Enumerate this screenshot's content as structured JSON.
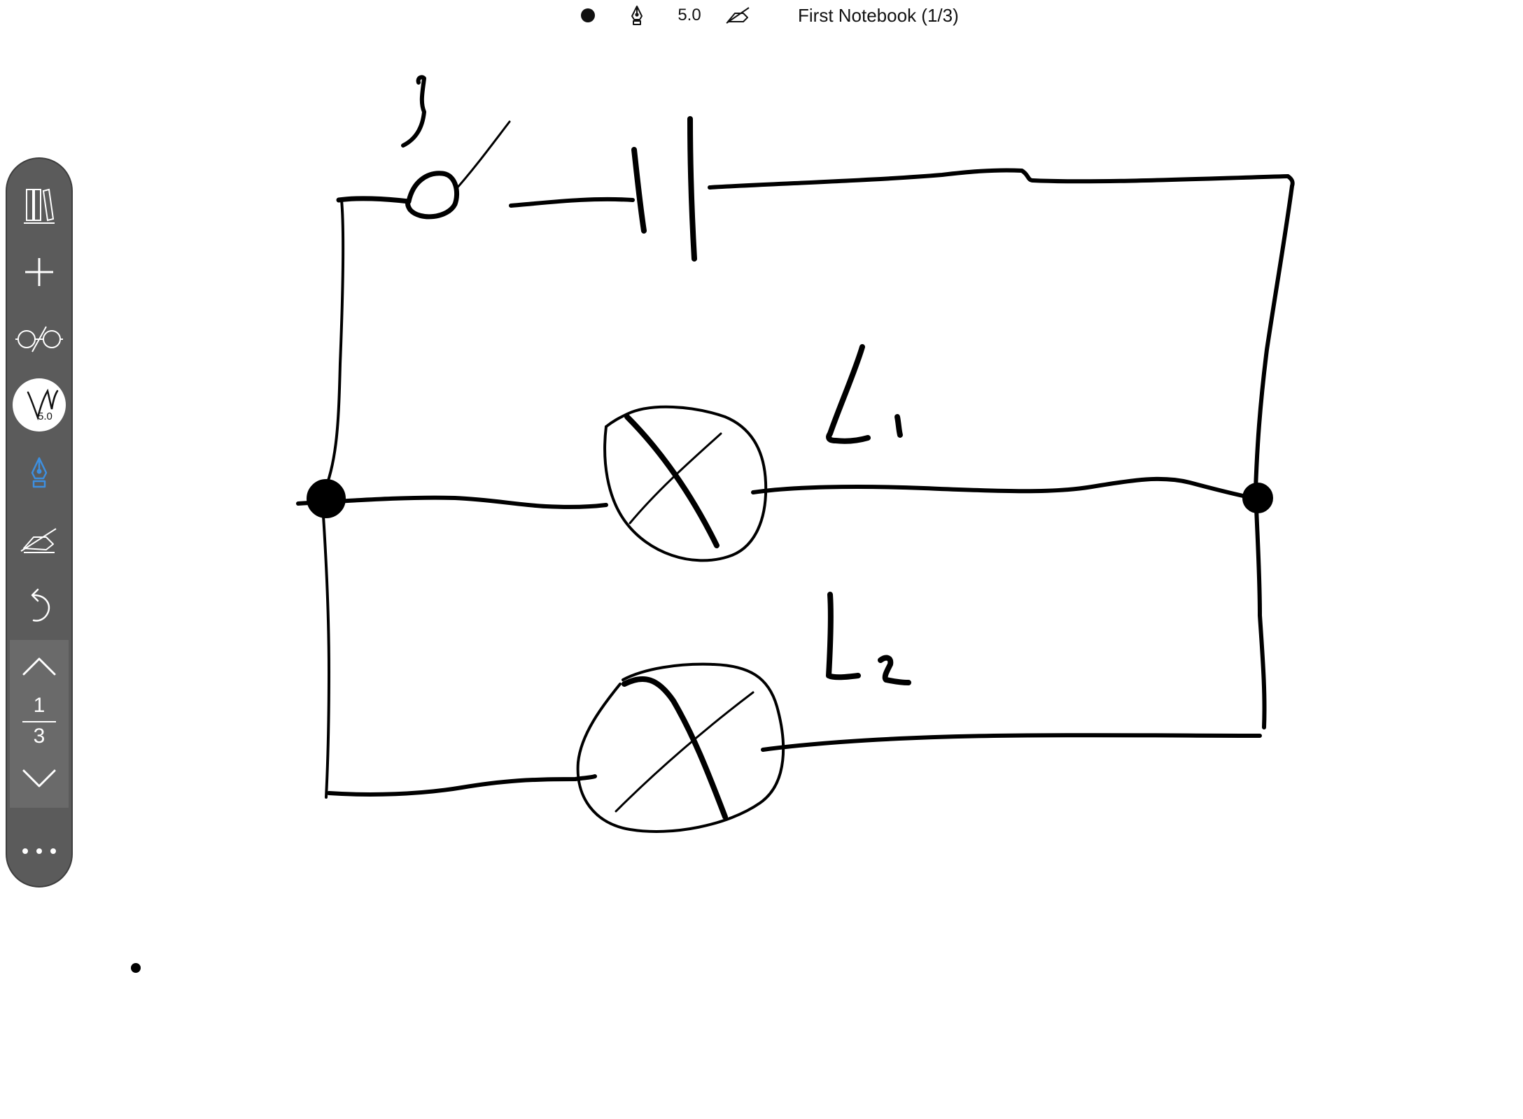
{
  "topbar": {
    "pen_size": "5.0",
    "notebook_title": "First Notebook (1/3)",
    "icons": [
      "brush-dot-icon",
      "fountain-pen-icon",
      "eraser-icon"
    ]
  },
  "toolbar": {
    "icons": [
      "library-icon",
      "plus-icon",
      "reading-glasses-icon",
      "brush-icon",
      "fountain-pen-icon",
      "eraser-icon",
      "undo-icon",
      "chevron-up-icon",
      "chevron-down-icon",
      "more-dots-icon"
    ],
    "brush_size": "5.0",
    "active_tool": "fountain-pen",
    "active_color": "#3d8fe0",
    "page_current": "1",
    "page_total": "3"
  },
  "canvas": {
    "drawing": "hand-drawn circuit sketch",
    "labels": [
      "L1",
      "L2"
    ]
  }
}
